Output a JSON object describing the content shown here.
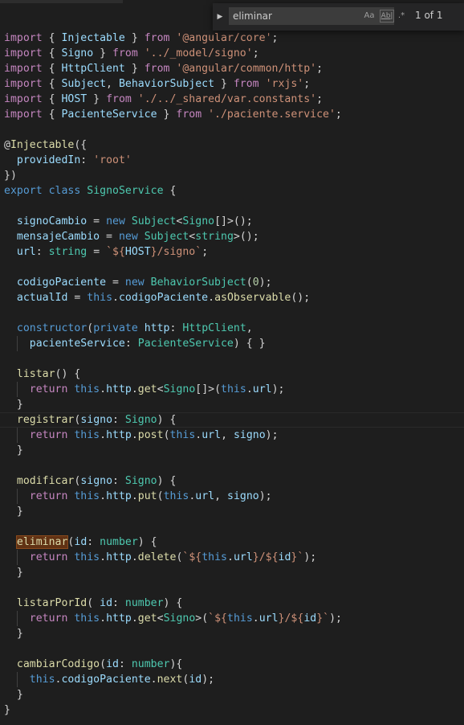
{
  "find_widget": {
    "query": "eliminar",
    "match_case_label": "Aa",
    "whole_word_label": "Ab|",
    "regex_label": ".*",
    "result_count": "1 of 1"
  },
  "code": {
    "lines": [
      [
        [
          "kw",
          "import"
        ],
        [
          "op",
          " { "
        ],
        [
          "var",
          "Injectable"
        ],
        [
          "op",
          " } "
        ],
        [
          "kw",
          "from"
        ],
        [
          "op",
          " "
        ],
        [
          "str",
          "'@angular/core'"
        ],
        [
          "op",
          ";"
        ]
      ],
      [
        [
          "kw",
          "import"
        ],
        [
          "op",
          " { "
        ],
        [
          "var",
          "Signo"
        ],
        [
          "op",
          " } "
        ],
        [
          "kw",
          "from"
        ],
        [
          "op",
          " "
        ],
        [
          "str",
          "'../_model/signo'"
        ],
        [
          "op",
          ";"
        ]
      ],
      [
        [
          "kw",
          "import"
        ],
        [
          "op",
          " { "
        ],
        [
          "var",
          "HttpClient"
        ],
        [
          "op",
          " } "
        ],
        [
          "kw",
          "from"
        ],
        [
          "op",
          " "
        ],
        [
          "str",
          "'@angular/common/http'"
        ],
        [
          "op",
          ";"
        ]
      ],
      [
        [
          "kw",
          "import"
        ],
        [
          "op",
          " { "
        ],
        [
          "var",
          "Subject"
        ],
        [
          "op",
          ", "
        ],
        [
          "var",
          "BehaviorSubject"
        ],
        [
          "op",
          " } "
        ],
        [
          "kw",
          "from"
        ],
        [
          "op",
          " "
        ],
        [
          "str",
          "'rxjs'"
        ],
        [
          "op",
          ";"
        ]
      ],
      [
        [
          "kw",
          "import"
        ],
        [
          "op",
          " { "
        ],
        [
          "var",
          "HOST"
        ],
        [
          "op",
          " } "
        ],
        [
          "kw",
          "from"
        ],
        [
          "op",
          " "
        ],
        [
          "str",
          "'./../_shared/var.constants'"
        ],
        [
          "op",
          ";"
        ]
      ],
      [
        [
          "kw",
          "import"
        ],
        [
          "op",
          " { "
        ],
        [
          "var",
          "PacienteService"
        ],
        [
          "op",
          " } "
        ],
        [
          "kw",
          "from"
        ],
        [
          "op",
          " "
        ],
        [
          "str",
          "'./paciente.service'"
        ],
        [
          "op",
          ";"
        ]
      ],
      [],
      [
        [
          "op",
          "@"
        ],
        [
          "fn",
          "Injectable"
        ],
        [
          "op",
          "({"
        ]
      ],
      [
        [
          "op",
          "  "
        ],
        [
          "var",
          "providedIn"
        ],
        [
          "op",
          ": "
        ],
        [
          "str",
          "'root'"
        ]
      ],
      [
        [
          "op",
          "})"
        ]
      ],
      [
        [
          "kw2",
          "export"
        ],
        [
          "op",
          " "
        ],
        [
          "kw2",
          "class"
        ],
        [
          "op",
          " "
        ],
        [
          "cls",
          "SignoService"
        ],
        [
          "op",
          " {"
        ]
      ],
      [],
      [
        [
          "op",
          "  "
        ],
        [
          "var",
          "signoCambio"
        ],
        [
          "op",
          " = "
        ],
        [
          "kw2",
          "new"
        ],
        [
          "op",
          " "
        ],
        [
          "cls",
          "Subject"
        ],
        [
          "op",
          "<"
        ],
        [
          "cls",
          "Signo"
        ],
        [
          "op",
          "[]>();"
        ]
      ],
      [
        [
          "op",
          "  "
        ],
        [
          "var",
          "mensajeCambio"
        ],
        [
          "op",
          " = "
        ],
        [
          "kw2",
          "new"
        ],
        [
          "op",
          " "
        ],
        [
          "cls",
          "Subject"
        ],
        [
          "op",
          "<"
        ],
        [
          "cls",
          "string"
        ],
        [
          "op",
          ">();"
        ]
      ],
      [
        [
          "op",
          "  "
        ],
        [
          "var",
          "url"
        ],
        [
          "op",
          ": "
        ],
        [
          "cls",
          "string"
        ],
        [
          "op",
          " = "
        ],
        [
          "tpl",
          "`${"
        ],
        [
          "var",
          "HOST"
        ],
        [
          "tpl",
          "}/signo`"
        ],
        [
          "op",
          ";"
        ]
      ],
      [],
      [
        [
          "op",
          "  "
        ],
        [
          "var",
          "codigoPaciente"
        ],
        [
          "op",
          " = "
        ],
        [
          "kw2",
          "new"
        ],
        [
          "op",
          " "
        ],
        [
          "cls",
          "BehaviorSubject"
        ],
        [
          "op",
          "("
        ],
        [
          "num",
          "0"
        ],
        [
          "op",
          ");"
        ]
      ],
      [
        [
          "op",
          "  "
        ],
        [
          "var",
          "actualId"
        ],
        [
          "op",
          " = "
        ],
        [
          "kw2",
          "this"
        ],
        [
          "op",
          "."
        ],
        [
          "var",
          "codigoPaciente"
        ],
        [
          "op",
          "."
        ],
        [
          "fn",
          "asObservable"
        ],
        [
          "op",
          "();"
        ]
      ],
      [],
      [
        [
          "op",
          "  "
        ],
        [
          "kw2",
          "constructor"
        ],
        [
          "op",
          "("
        ],
        [
          "kw2",
          "private"
        ],
        [
          "op",
          " "
        ],
        [
          "var",
          "http"
        ],
        [
          "op",
          ": "
        ],
        [
          "cls",
          "HttpClient"
        ],
        [
          "op",
          ","
        ]
      ],
      [
        [
          "op",
          "    "
        ],
        [
          "var",
          "pacienteService"
        ],
        [
          "op",
          ": "
        ],
        [
          "cls",
          "PacienteService"
        ],
        [
          "op",
          ") { }"
        ]
      ],
      [],
      [
        [
          "op",
          "  "
        ],
        [
          "fn",
          "listar"
        ],
        [
          "op",
          "() {"
        ]
      ],
      [
        [
          "op",
          "    "
        ],
        [
          "kw",
          "return"
        ],
        [
          "op",
          " "
        ],
        [
          "kw2",
          "this"
        ],
        [
          "op",
          "."
        ],
        [
          "var",
          "http"
        ],
        [
          "op",
          "."
        ],
        [
          "fn",
          "get"
        ],
        [
          "op",
          "<"
        ],
        [
          "cls",
          "Signo"
        ],
        [
          "op",
          "[]>("
        ],
        [
          "kw2",
          "this"
        ],
        [
          "op",
          "."
        ],
        [
          "var",
          "url"
        ],
        [
          "op",
          ");"
        ]
      ],
      [
        [
          "op",
          "  }"
        ]
      ],
      [
        [
          "op",
          "  "
        ],
        [
          "fn",
          "registrar"
        ],
        [
          "op",
          "("
        ],
        [
          "var",
          "signo"
        ],
        [
          "op",
          ": "
        ],
        [
          "cls",
          "Signo"
        ],
        [
          "op",
          ") {"
        ]
      ],
      [
        [
          "op",
          "    "
        ],
        [
          "kw",
          "return"
        ],
        [
          "op",
          " "
        ],
        [
          "kw2",
          "this"
        ],
        [
          "op",
          "."
        ],
        [
          "var",
          "http"
        ],
        [
          "op",
          "."
        ],
        [
          "fn",
          "post"
        ],
        [
          "op",
          "("
        ],
        [
          "kw2",
          "this"
        ],
        [
          "op",
          "."
        ],
        [
          "var",
          "url"
        ],
        [
          "op",
          ", "
        ],
        [
          "var",
          "signo"
        ],
        [
          "op",
          ");"
        ]
      ],
      [
        [
          "op",
          "  }"
        ]
      ],
      [],
      [
        [
          "op",
          "  "
        ],
        [
          "fn",
          "modificar"
        ],
        [
          "op",
          "("
        ],
        [
          "var",
          "signo"
        ],
        [
          "op",
          ": "
        ],
        [
          "cls",
          "Signo"
        ],
        [
          "op",
          ") {"
        ]
      ],
      [
        [
          "op",
          "    "
        ],
        [
          "kw",
          "return"
        ],
        [
          "op",
          " "
        ],
        [
          "kw2",
          "this"
        ],
        [
          "op",
          "."
        ],
        [
          "var",
          "http"
        ],
        [
          "op",
          "."
        ],
        [
          "fn",
          "put"
        ],
        [
          "op",
          "("
        ],
        [
          "kw2",
          "this"
        ],
        [
          "op",
          "."
        ],
        [
          "var",
          "url"
        ],
        [
          "op",
          ", "
        ],
        [
          "var",
          "signo"
        ],
        [
          "op",
          ");"
        ]
      ],
      [
        [
          "op",
          "  }"
        ]
      ],
      [],
      [
        [
          "op",
          "  "
        ],
        [
          "match",
          "eliminar"
        ],
        [
          "op",
          "("
        ],
        [
          "var",
          "id"
        ],
        [
          "op",
          ": "
        ],
        [
          "cls",
          "number"
        ],
        [
          "op",
          ") {"
        ]
      ],
      [
        [
          "op",
          "    "
        ],
        [
          "kw",
          "return"
        ],
        [
          "op",
          " "
        ],
        [
          "kw2",
          "this"
        ],
        [
          "op",
          "."
        ],
        [
          "var",
          "http"
        ],
        [
          "op",
          "."
        ],
        [
          "fn",
          "delete"
        ],
        [
          "op",
          "("
        ],
        [
          "tpl",
          "`${"
        ],
        [
          "kw2",
          "this"
        ],
        [
          "op",
          "."
        ],
        [
          "var",
          "url"
        ],
        [
          "tpl",
          "}/${"
        ],
        [
          "var",
          "id"
        ],
        [
          "tpl",
          "}`"
        ],
        [
          "op",
          ");"
        ]
      ],
      [
        [
          "op",
          "  }"
        ]
      ],
      [],
      [
        [
          "op",
          "  "
        ],
        [
          "fn",
          "listarPorId"
        ],
        [
          "op",
          "( "
        ],
        [
          "var",
          "id"
        ],
        [
          "op",
          ": "
        ],
        [
          "cls",
          "number"
        ],
        [
          "op",
          ") {"
        ]
      ],
      [
        [
          "op",
          "    "
        ],
        [
          "kw",
          "return"
        ],
        [
          "op",
          " "
        ],
        [
          "kw2",
          "this"
        ],
        [
          "op",
          "."
        ],
        [
          "var",
          "http"
        ],
        [
          "op",
          "."
        ],
        [
          "fn",
          "get"
        ],
        [
          "op",
          "<"
        ],
        [
          "cls",
          "Signo"
        ],
        [
          "op",
          ">("
        ],
        [
          "tpl",
          "`${"
        ],
        [
          "kw2",
          "this"
        ],
        [
          "op",
          "."
        ],
        [
          "var",
          "url"
        ],
        [
          "tpl",
          "}/${"
        ],
        [
          "var",
          "id"
        ],
        [
          "tpl",
          "}`"
        ],
        [
          "op",
          ");"
        ]
      ],
      [
        [
          "op",
          "  }"
        ]
      ],
      [],
      [
        [
          "op",
          "  "
        ],
        [
          "fn",
          "cambiarCodigo"
        ],
        [
          "op",
          "("
        ],
        [
          "var",
          "id"
        ],
        [
          "op",
          ": "
        ],
        [
          "cls",
          "number"
        ],
        [
          "op",
          "){"
        ]
      ],
      [
        [
          "op",
          "    "
        ],
        [
          "kw2",
          "this"
        ],
        [
          "op",
          "."
        ],
        [
          "var",
          "codigoPaciente"
        ],
        [
          "op",
          "."
        ],
        [
          "fn",
          "next"
        ],
        [
          "op",
          "("
        ],
        [
          "var",
          "id"
        ],
        [
          "op",
          ");"
        ]
      ],
      [
        [
          "op",
          "  }"
        ]
      ],
      [
        [
          "op",
          "}"
        ]
      ]
    ],
    "cursor_line_index": 25,
    "colors": {
      "keyword_control": "#c586c0",
      "keyword": "#569cd6",
      "string": "#ce9178",
      "type": "#4ec9b0",
      "variable": "#9cdcfe",
      "function": "#dcdcaa",
      "number": "#b5cea8",
      "match_highlight": "#613214"
    }
  }
}
